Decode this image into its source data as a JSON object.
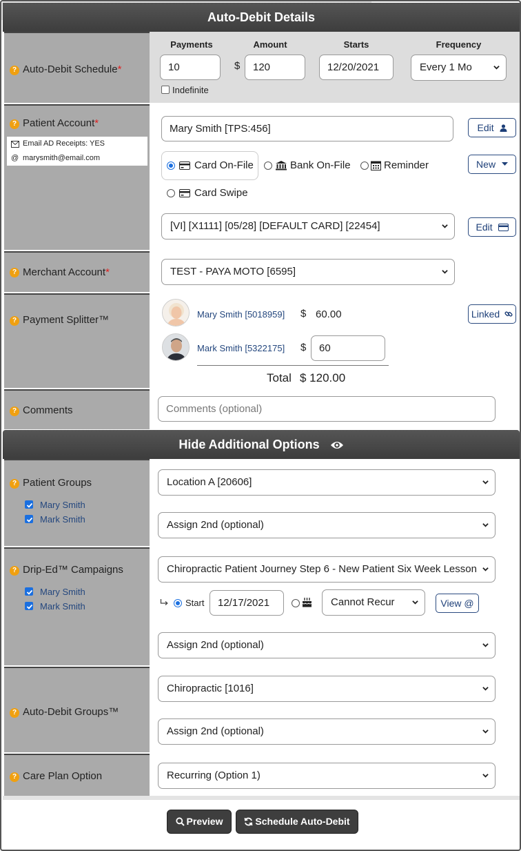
{
  "header": {
    "title": "Auto-Debit Details"
  },
  "schedule": {
    "label": "Auto-Debit Schedule",
    "required_mark": "*",
    "payments_header": "Payments",
    "amount_header": "Amount",
    "starts_header": "Starts",
    "frequency_header": "Frequency",
    "payments_value": "10",
    "currency": "$",
    "amount_value": "120",
    "starts_value": "12/20/2021",
    "frequency_value": "Every 1 Mo",
    "indefinite_label": "Indefinite"
  },
  "patient_account": {
    "label": "Patient Account",
    "required_mark": "*",
    "email_receipts": "Email AD Receipts: YES",
    "email": "marysmith@email.com",
    "patient_value": "Mary Smith [TPS:456]",
    "edit_label": "Edit",
    "new_label": "New",
    "options": {
      "card_on_file": "Card On-File",
      "bank_on_file": "Bank On-File",
      "reminder": "Reminder",
      "card_swipe": "Card Swipe"
    },
    "card_value": "[VI] [X1111] [05/28] [DEFAULT CARD] [22454]",
    "edit_card_label": "Edit"
  },
  "merchant": {
    "label": "Merchant Account",
    "required_mark": "*",
    "value": "TEST - PAYA MOTO [6595]"
  },
  "splitter": {
    "label": "Payment Splitter™",
    "linked_label": "Linked",
    "currency": "$",
    "rows": [
      {
        "name": "Mary Smith [5018959]",
        "amount": "60.00"
      },
      {
        "name": "Mark Smith [5322175]",
        "amount": "60"
      }
    ],
    "total_label": "Total",
    "total_value": "$ 120.00"
  },
  "comments": {
    "label": "Comments",
    "placeholder": "Comments (optional)"
  },
  "additional": {
    "title": "Hide Additional Options"
  },
  "patient_groups": {
    "label": "Patient Groups",
    "members": [
      "Mary Smith",
      "Mark Smith"
    ],
    "group1": "Location A [20606]",
    "group2": "Assign 2nd (optional)"
  },
  "drip": {
    "label": "Drip-Ed™ Campaigns",
    "members": [
      "Mary Smith",
      "Mark Smith"
    ],
    "campaign": "Chiropractic Patient Journey Step 6 - New Patient Six Week Lesson",
    "start_label": "Start",
    "start_date": "12/17/2021",
    "recur_value": "Cannot Recur",
    "view_label": "View @",
    "assign2": "Assign 2nd (optional)"
  },
  "ad_groups": {
    "label": "Auto-Debit Groups™",
    "group1": "Chiropractic [1016]",
    "group2": "Assign 2nd (optional)"
  },
  "care_plan": {
    "label": "Care Plan Option",
    "value": "Recurring (Option 1)"
  },
  "actions": {
    "preview": "Preview",
    "schedule": "Schedule Auto-Debit"
  }
}
